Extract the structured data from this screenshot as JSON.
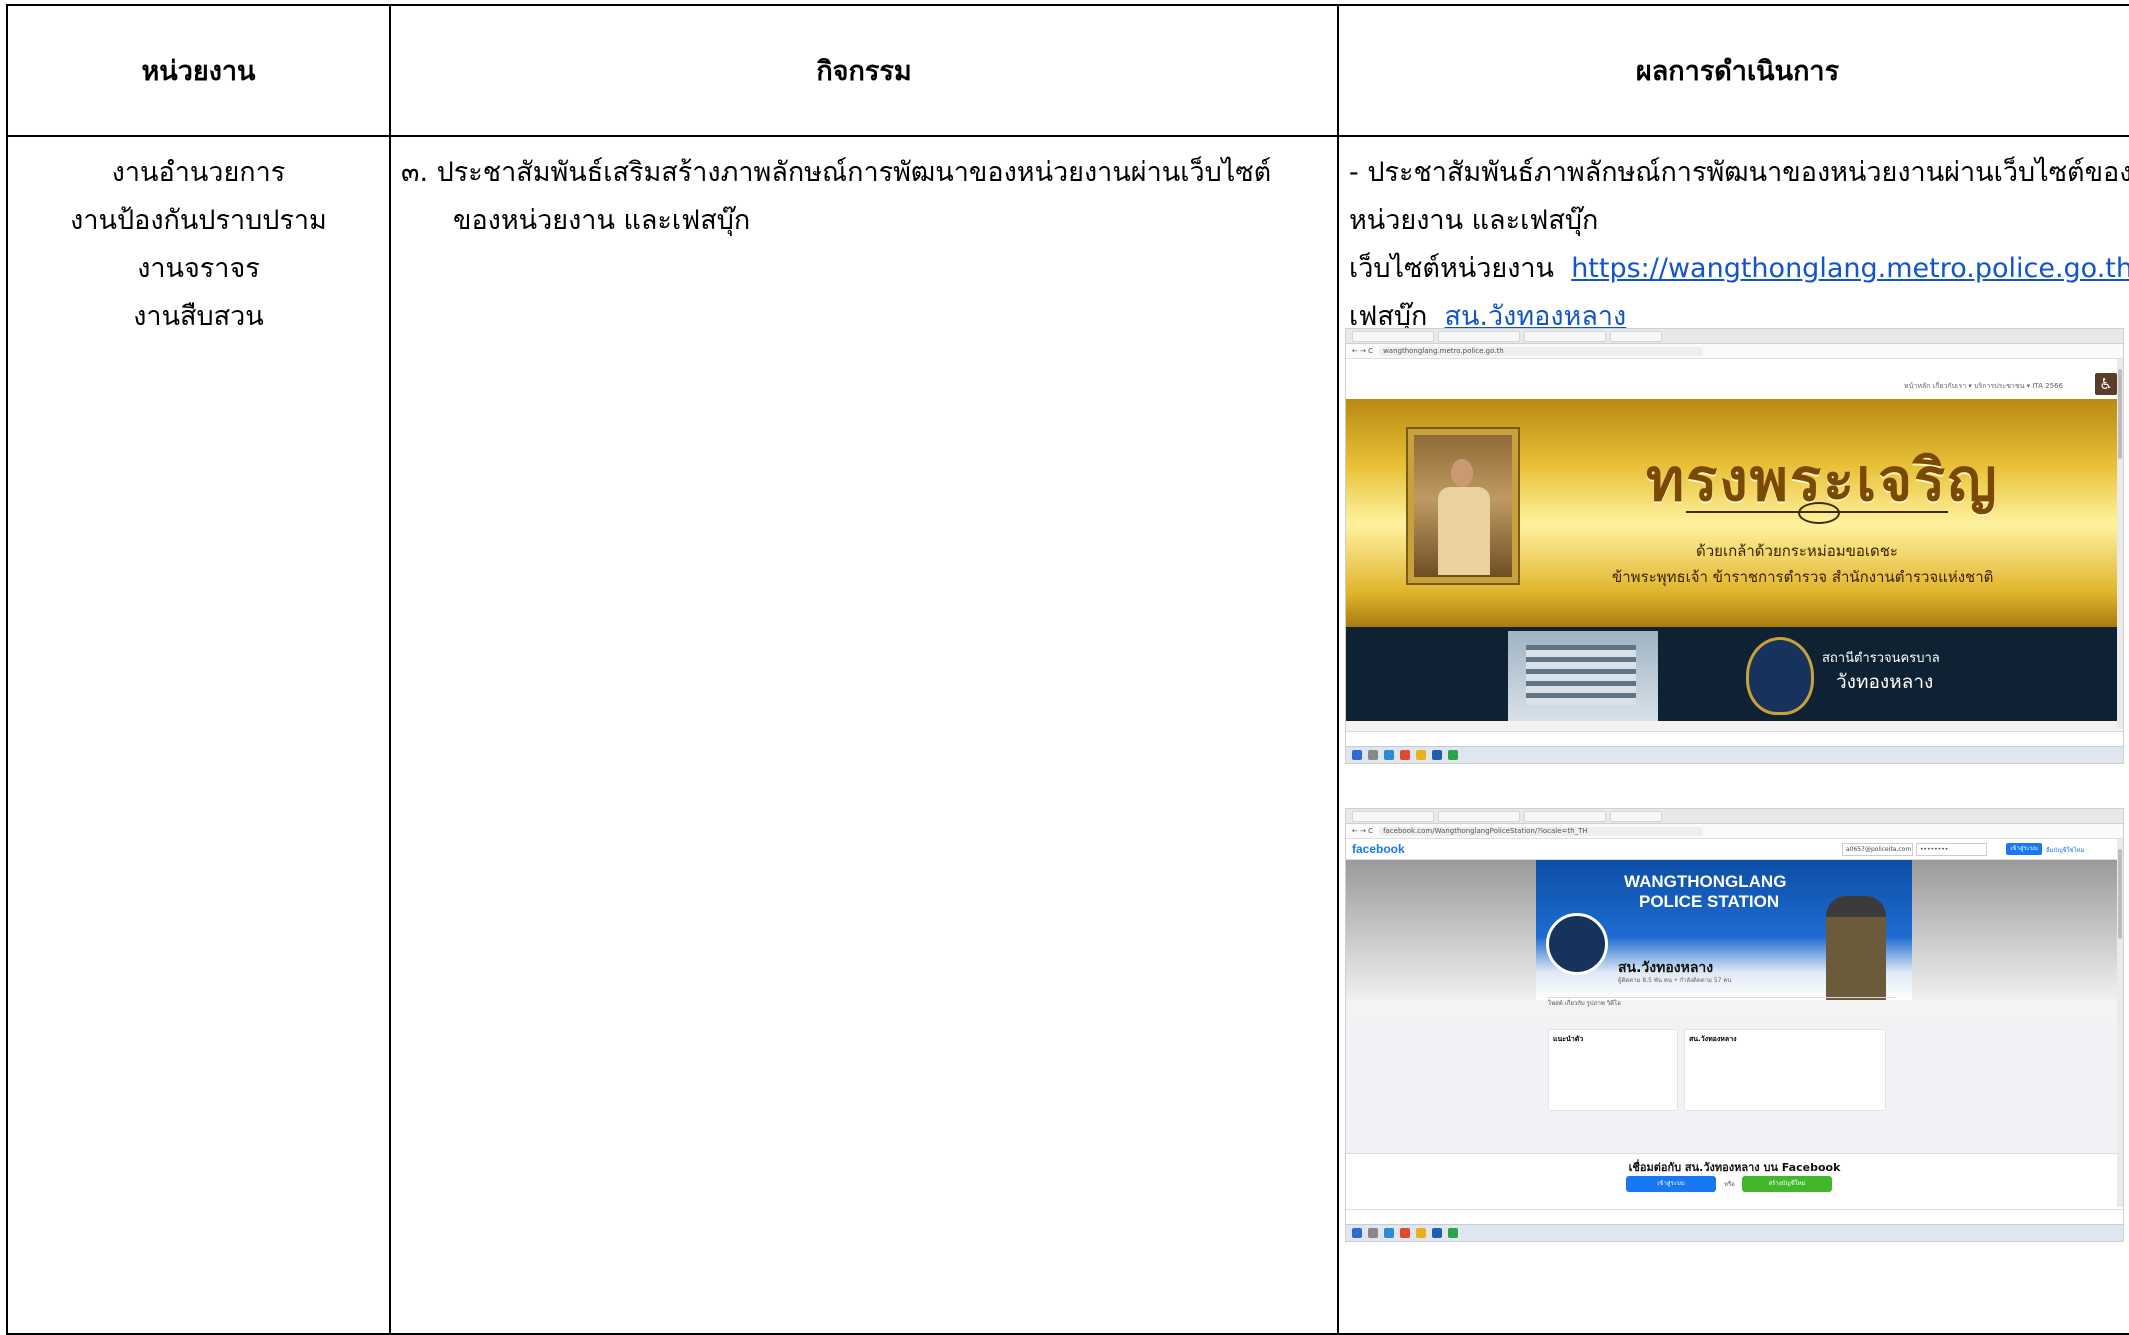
{
  "table": {
    "headers": [
      "หน่วยงาน",
      "กิจกรรม",
      "ผลการดำเนินการ"
    ],
    "units": [
      "งานอำนวยการ",
      "งานป้องกันปราบปราม",
      "งานจราจร",
      "งานสืบสวน"
    ],
    "activity": {
      "line1": "๓. ประชาสัมพันธ์เสริมสร้างภาพลักษณ์การพัฒนาของหน่วยงานผ่านเว็บไซต์",
      "line2": "ของหน่วยงาน และเฟสบุ๊ก"
    },
    "result": {
      "line1": "- ประชาสัมพันธ์ภาพลักษณ์การพัฒนาของหน่วยงานผ่านเว็บไซต์ของ",
      "line2": "หน่วยงาน และเฟสบุ๊ก",
      "website_label": "เว็บไซต์หน่วยงาน",
      "website_url": "https://wangthonglang.metro.police.go.th",
      "facebook_label": "เฟสบุ๊ก",
      "facebook_link": "สน.วังทองหลาง"
    }
  },
  "screenshot1": {
    "address": "wangthonglang.metro.police.go.th",
    "menu": "หน้าหลัก เกี่ยวกับเรา ▾ บริการประชาชน ▾ ITA 2566",
    "banner_title": "ทรงพระเจริญ",
    "banner_line1": "ด้วยเกล้าด้วยกระหม่อมขอเดชะ",
    "banner_line2": "ข้าพระพุทธเจ้า ข้าราชการตำรวจ สำนักงานตำรวจแห่งชาติ",
    "station_line1": "สถานีตำรวจนครบาล",
    "station_line2": "วังทองหลาง",
    "accessibility_icon": "♿"
  },
  "screenshot2": {
    "address": "facebook.com/WangthonglangPoliceStation/?locale=th_TH",
    "logo": "facebook",
    "email": "a0657@policeita.com",
    "password": "••••••••",
    "login_button": "เข้าสู่ระบบ",
    "forgot_link": "ลืมบัญชีใช่ไหม",
    "cover_line1": "WANGTHONGLANG",
    "cover_line2": "POLICE STATION",
    "page_name": "สน.วังทองหลาง",
    "page_sub": "ผู้ติดตาม 8.5 พัน คน • กำลังติดตาม 57 คน",
    "tabs": "โพสต์  เกี่ยวกับ  รูปภาพ  วิดีโอ",
    "intro_title": "แนะนำตัว",
    "post_author": "สน.วังทองหลาง",
    "connect_text": "เชื่อมต่อกับ สน.วังทองหลาง บน Facebook",
    "connect_login": "เข้าสู่ระบบ",
    "connect_or": "หรือ",
    "connect_signup": "สร้างบัญชีใหม่"
  }
}
